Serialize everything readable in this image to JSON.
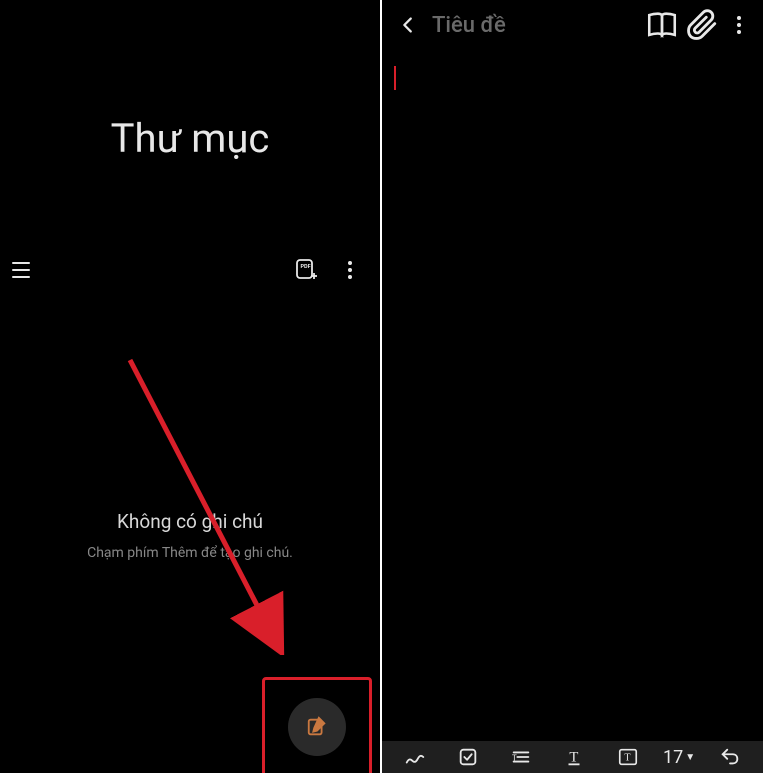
{
  "left": {
    "title": "Thư mục",
    "emptyTitle": "Không có ghi chú",
    "emptySubtitle": "Chạm phím Thêm để tạo ghi chú."
  },
  "right": {
    "titlePlaceholder": "Tiêu đề",
    "fontSize": "17"
  },
  "colors": {
    "accent": "#d91f2a",
    "highlight": "#d91f2a"
  }
}
